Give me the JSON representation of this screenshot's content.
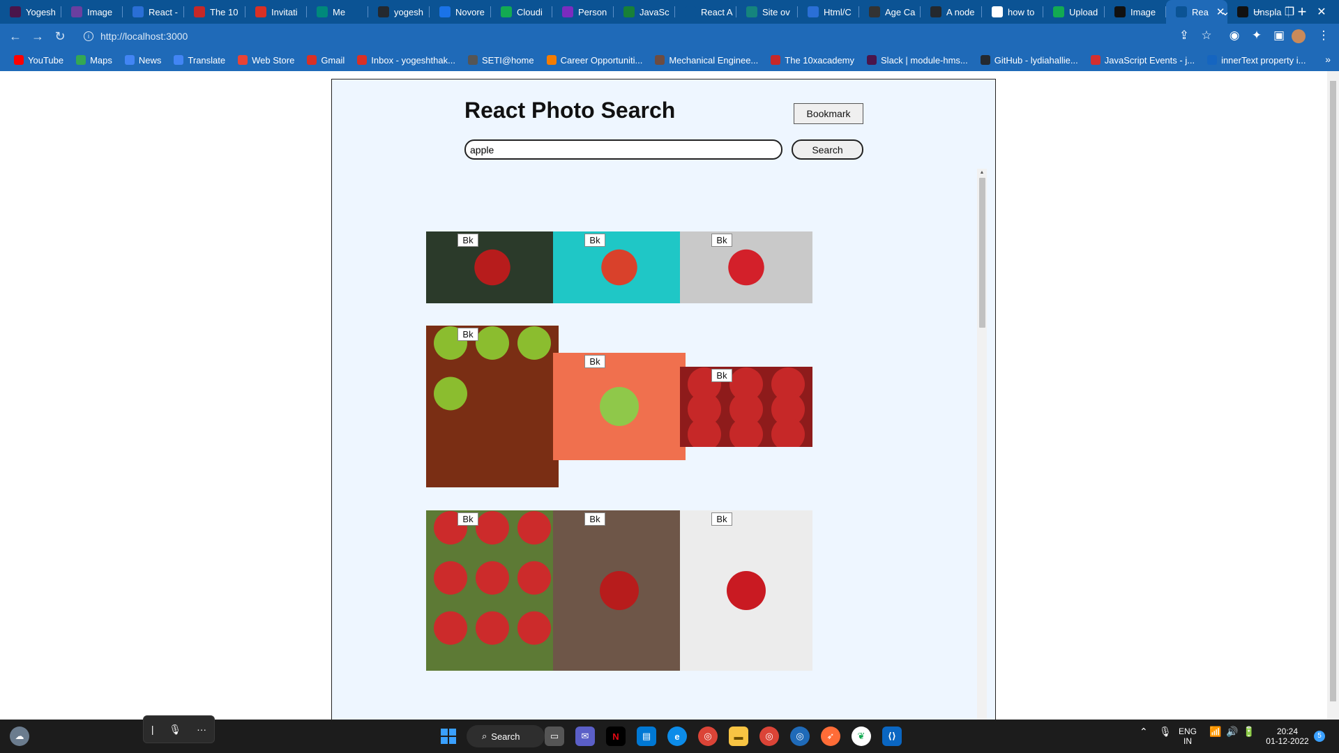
{
  "browser": {
    "tabs": [
      {
        "label": "Yogesh",
        "icon": "slack-icon",
        "color": "#4a154b"
      },
      {
        "label": "Image",
        "icon": "forms-icon",
        "color": "#6b3fa0"
      },
      {
        "label": "React -",
        "icon": "docs-icon",
        "color": "#2a6fd6"
      },
      {
        "label": "The 10",
        "icon": "tenx-icon",
        "color": "#c62828"
      },
      {
        "label": "Invitati",
        "icon": "gmail-icon",
        "color": "#d93025"
      },
      {
        "label": "Me",
        "icon": "meet-icon",
        "color": "#00897b"
      },
      {
        "label": "yogesh",
        "icon": "github-icon",
        "color": "#24292f"
      },
      {
        "label": "Novore",
        "icon": "novoresume-icon",
        "color": "#1a73e8"
      },
      {
        "label": "Cloudi",
        "icon": "mongodb-icon",
        "color": "#13aa52"
      },
      {
        "label": "Person",
        "icon": "persona-icon",
        "color": "#7b2cbf"
      },
      {
        "label": "JavaSc",
        "icon": "chrome-icon",
        "color": "#188038"
      },
      {
        "label": "React A",
        "icon": "react-icon",
        "color": "#0b5394"
      },
      {
        "label": "Site ov",
        "icon": "netlify-icon",
        "color": "#15847d"
      },
      {
        "label": "Html/C",
        "icon": "docs-icon",
        "color": "#2a6fd6"
      },
      {
        "label": "Age Ca",
        "icon": "chrome-icon",
        "color": "#333333"
      },
      {
        "label": "A node",
        "icon": "github-icon",
        "color": "#24292f"
      },
      {
        "label": "how to",
        "icon": "google-icon",
        "color": "#ffffff"
      },
      {
        "label": "Upload",
        "icon": "mongodb-icon",
        "color": "#13aa52"
      },
      {
        "label": "Image",
        "icon": "unsplash-icon",
        "color": "#111111"
      },
      {
        "label": "Rea",
        "icon": "react-icon",
        "color": "#0b5394",
        "active": true
      },
      {
        "label": "Unspla",
        "icon": "unsplash-icon",
        "color": "#111111"
      }
    ],
    "url": "http://localhost:3000",
    "bookmarks": [
      {
        "label": "YouTube",
        "color": "#ff0000"
      },
      {
        "label": "Maps",
        "color": "#34a853"
      },
      {
        "label": "News",
        "color": "#4285f4"
      },
      {
        "label": "Translate",
        "color": "#4285f4"
      },
      {
        "label": "Web Store",
        "color": "#ea4335"
      },
      {
        "label": "Gmail",
        "color": "#d93025"
      },
      {
        "label": "Inbox - yogeshthak...",
        "color": "#d93025"
      },
      {
        "label": "SETI@home",
        "color": "#555555"
      },
      {
        "label": "Career Opportuniti...",
        "color": "#f57c00"
      },
      {
        "label": "Mechanical Enginee...",
        "color": "#6d4c41"
      },
      {
        "label": "The 10xacademy",
        "color": "#c62828"
      },
      {
        "label": "Slack | module-hms...",
        "color": "#4a154b"
      },
      {
        "label": "GitHub - lydiahallie...",
        "color": "#24292f"
      },
      {
        "label": "JavaScript Events - j...",
        "color": "#d32f2f"
      },
      {
        "label": "innerText property i...",
        "color": "#1565c0"
      }
    ],
    "more_bookmarks": "»"
  },
  "app": {
    "title": "React Photo Search",
    "bookmark_label": "Bookmark",
    "search_value": "apple",
    "search_label": "Search",
    "bk_label": "Bk",
    "photos": [
      {
        "name": "photo-hand-holding-apple",
        "bg": "#2b3a2a",
        "apple": "#b71c1c"
      },
      {
        "name": "photo-apple-on-teal",
        "bg": "#1fc7c6",
        "apple": "#d9412b"
      },
      {
        "name": "photo-apple-on-gray",
        "bg": "#c9c9c9",
        "apple": "#d3202a"
      },
      {
        "name": "photo-green-apples-bowl",
        "bg": "#7a2e14",
        "apple": "#8bbd2f"
      },
      {
        "name": "photo-apple-slices-orange",
        "bg": "#f0704e",
        "apple": "#8fc84a"
      },
      {
        "name": "photo-red-apples-pile",
        "bg": "#8e1b1b",
        "apple": "#c62828"
      },
      {
        "name": "photo-apples-on-tree",
        "bg": "#5d7a35",
        "apple": "#cc2b2b"
      },
      {
        "name": "photo-apple-on-table",
        "bg": "#6e5648",
        "apple": "#b71c1c"
      },
      {
        "name": "photo-apple-on-white",
        "bg": "#ececec",
        "apple": "#c91a22"
      }
    ]
  },
  "taskbar": {
    "search_label": "Search",
    "lang_line1": "ENG",
    "lang_line2": "IN",
    "time": "20:24",
    "date": "01-12-2022",
    "notification_count": "5"
  }
}
